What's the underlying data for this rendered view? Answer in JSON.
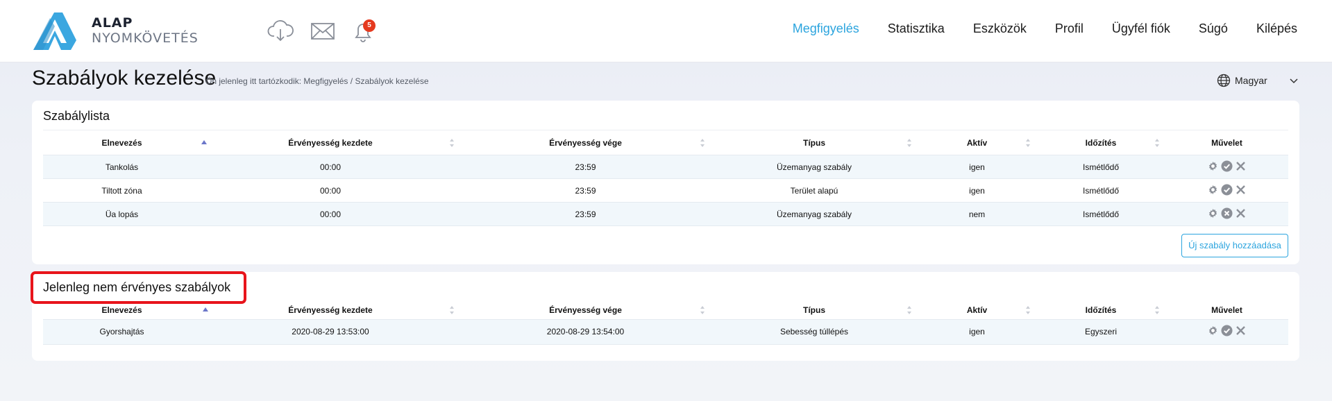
{
  "header": {
    "brand_line1": "ALAP",
    "brand_line2": "NYOMKÖVETÉS",
    "notification_count": "5",
    "nav": [
      "Megfigyelés",
      "Statisztika",
      "Eszközök",
      "Profil",
      "Ügyfél fiók",
      "Súgó",
      "Kilépés"
    ],
    "active_nav": "Megfigyelés",
    "icons": [
      "cloud-download-icon",
      "mail-icon",
      "bell-icon"
    ]
  },
  "page": {
    "title": "Szabályok kezelése",
    "breadcrumb": "Ön jelenleg itt tartózkodik: Megfigyelés / Szabályok kezelése",
    "language": "Magyar"
  },
  "columns": [
    "Elnevezés",
    "Érvényesség kezdete",
    "Érvényesség vége",
    "Típus",
    "Aktív",
    "Időzítés",
    "Művelet"
  ],
  "rule_list": {
    "title": "Szabálylista",
    "rows": [
      {
        "name": "Tankolás",
        "start": "00:00",
        "end": "23:59",
        "type": "Üzemanyag szabály",
        "active": "igen",
        "timing": "Ismétlődő"
      },
      {
        "name": "Tiltott zóna",
        "start": "00:00",
        "end": "23:59",
        "type": "Terület alapú",
        "active": "igen",
        "timing": "Ismétlődő"
      },
      {
        "name": "Üa lopás",
        "start": "00:00",
        "end": "23:59",
        "type": "Üzemanyag szabály",
        "active": "nem",
        "timing": "Ismétlődő"
      }
    ],
    "add_button": "Új szabály hozzáadása"
  },
  "inactive_rules": {
    "title": "Jelenleg nem érvényes szabályok",
    "rows": [
      {
        "name": "Gyorshajtás",
        "start": "2020-08-29 13:53:00",
        "end": "2020-08-29 13:54:00",
        "type": "Sebesség túllépés",
        "active": "igen",
        "timing": "Egyszeri"
      }
    ]
  },
  "colors": {
    "accent": "#2ba4de",
    "highlight_border": "#e8141b",
    "badge": "#e53a1f",
    "row_stripe": "#f1f7fb"
  }
}
